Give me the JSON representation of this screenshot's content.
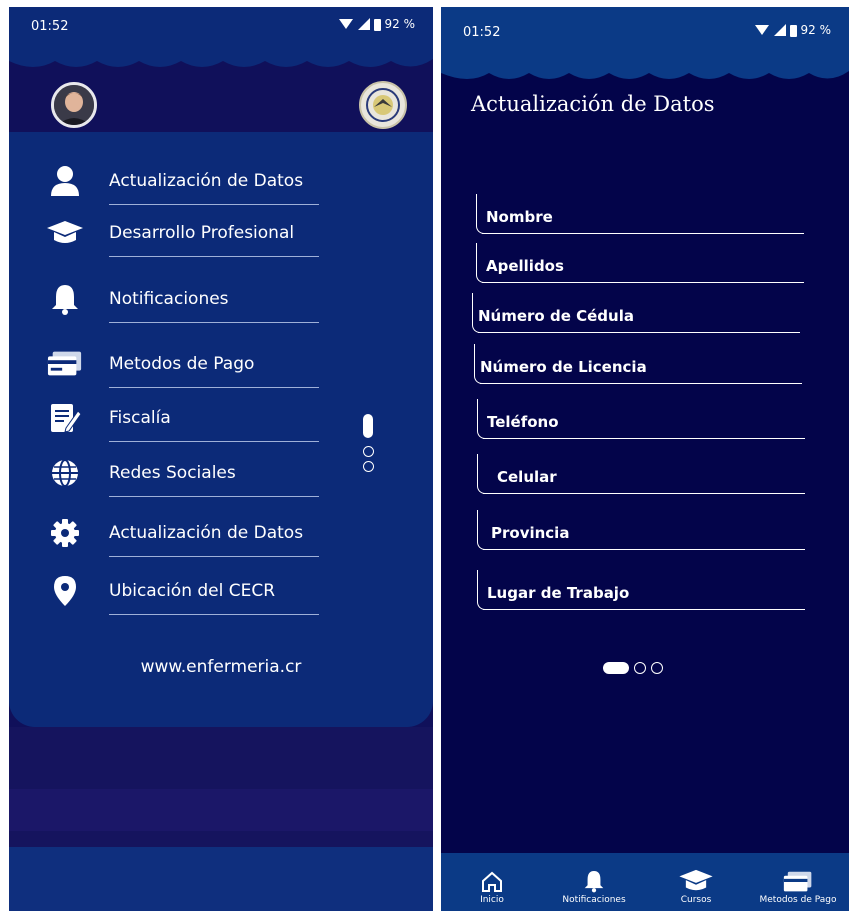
{
  "left_screen": {
    "status": {
      "time": "01:52",
      "battery": "92 %"
    },
    "menu": {
      "items": [
        {
          "label": "Actualización de Datos",
          "icon": "person-icon"
        },
        {
          "label": "Desarrollo Profesional",
          "icon": "graduation-cap-icon"
        },
        {
          "label": "Notificaciones",
          "icon": "bell-icon"
        },
        {
          "label": "Metodos de Pago",
          "icon": "credit-card-icon"
        },
        {
          "label": "Fiscalía",
          "icon": "document-edit-icon"
        },
        {
          "label": "Redes Sociales",
          "icon": "globe-icon"
        },
        {
          "label": "Actualización de Datos",
          "icon": "gear-icon"
        },
        {
          "label": "Ubicación del CECR",
          "icon": "location-pin-icon"
        }
      ]
    },
    "website": "www.enfermeria.cr"
  },
  "right_screen": {
    "status": {
      "time": "01:52",
      "battery": "92 %"
    },
    "title": "Actualización de Datos",
    "fields": [
      {
        "label": "Nombre"
      },
      {
        "label": "Apellidos"
      },
      {
        "label": "Número de Cédula"
      },
      {
        "label": "Número de Licencia"
      },
      {
        "label": "Teléfono"
      },
      {
        "label": "Celular"
      },
      {
        "label": "Provincia"
      },
      {
        "label": "Lugar de Trabajo"
      }
    ],
    "bottom_nav": [
      {
        "label": "Inicio",
        "icon": "home-icon"
      },
      {
        "label": "Notificaciones",
        "icon": "bell-icon"
      },
      {
        "label": "Cursos",
        "icon": "graduation-cap-icon"
      },
      {
        "label": "Metodos de Pago",
        "icon": "credit-card-icon"
      }
    ]
  },
  "colors": {
    "drawer_bg": "#0c2a78",
    "screen_bg": "#03044a",
    "nav_bg": "#0b3a86",
    "text": "#ffffff"
  }
}
